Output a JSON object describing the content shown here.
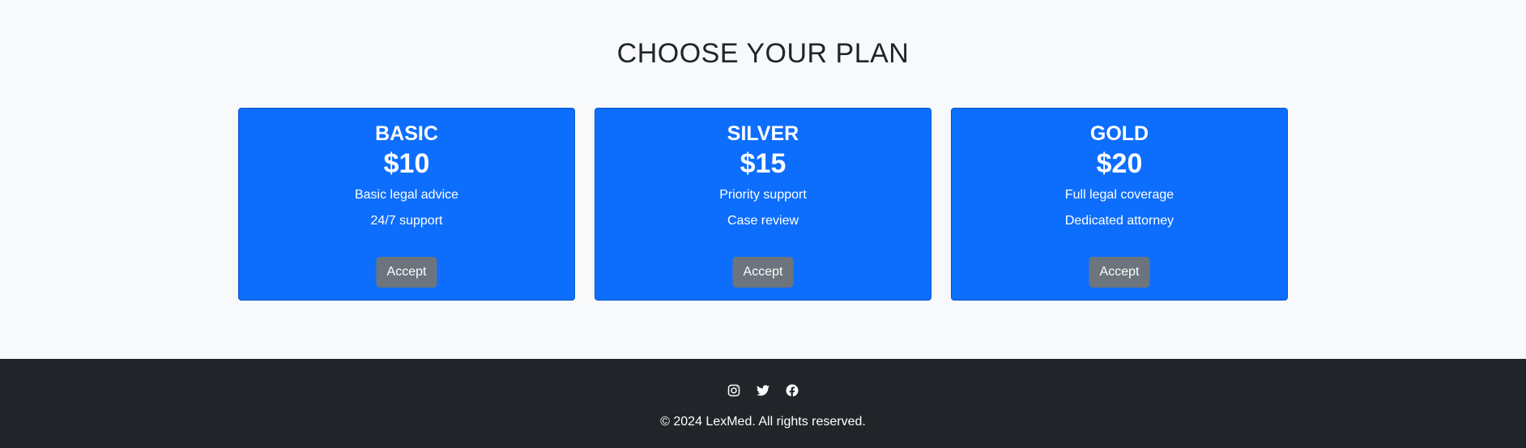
{
  "pricing": {
    "title": "CHOOSE YOUR PLAN",
    "plans": [
      {
        "name": "BASIC",
        "price": "$10",
        "features": [
          "Basic legal advice",
          "24/7 support"
        ],
        "button_label": "Accept"
      },
      {
        "name": "SILVER",
        "price": "$15",
        "features": [
          "Priority support",
          "Case review"
        ],
        "button_label": "Accept"
      },
      {
        "name": "GOLD",
        "price": "$20",
        "features": [
          "Full legal coverage",
          "Dedicated attorney"
        ],
        "button_label": "Accept"
      }
    ]
  },
  "footer": {
    "social": [
      {
        "icon": "instagram-icon"
      },
      {
        "icon": "twitter-icon"
      },
      {
        "icon": "facebook-icon"
      }
    ],
    "copyright": "© 2024 LexMed. All rights reserved."
  },
  "colors": {
    "card_background": "#0d6efd",
    "button_background": "#6c757d",
    "footer_background": "#212529",
    "page_background": "#f8f9fa"
  }
}
